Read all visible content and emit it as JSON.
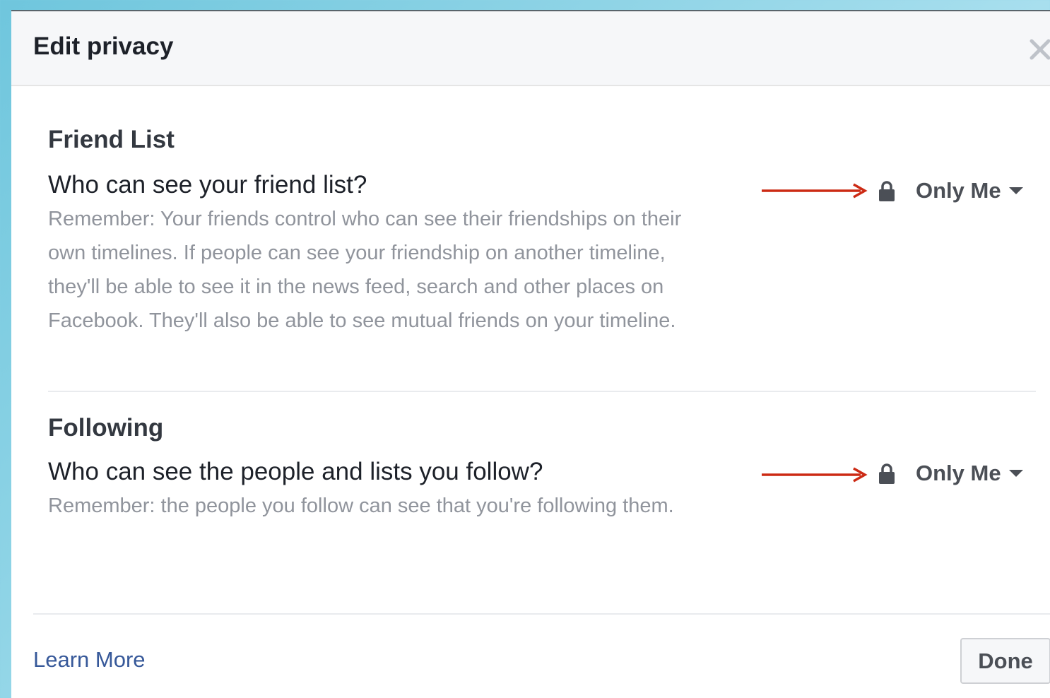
{
  "dialog": {
    "title": "Edit privacy",
    "close_icon": "close-icon"
  },
  "sections": [
    {
      "title": "Friend List",
      "question": "Who can see your friend list?",
      "note": "Remember: Your friends control who can see their friendships on their own timelines. If people can see your friendship on another timeline, they'll be able to see it in the news feed, search and other places on Facebook. They'll also be able to see mutual friends on your timeline.",
      "audience": "Only Me",
      "audience_icon": "lock-icon"
    },
    {
      "title": "Following",
      "question": "Who can see the people and lists you follow?",
      "note": "Remember: the people you follow can see that you're following them.",
      "audience": "Only Me",
      "audience_icon": "lock-icon"
    }
  ],
  "footer": {
    "learn_more": "Learn More",
    "done": "Done"
  },
  "colors": {
    "annotation_arrow": "#cc2a14",
    "link": "#365899",
    "muted_text": "#90949c"
  }
}
